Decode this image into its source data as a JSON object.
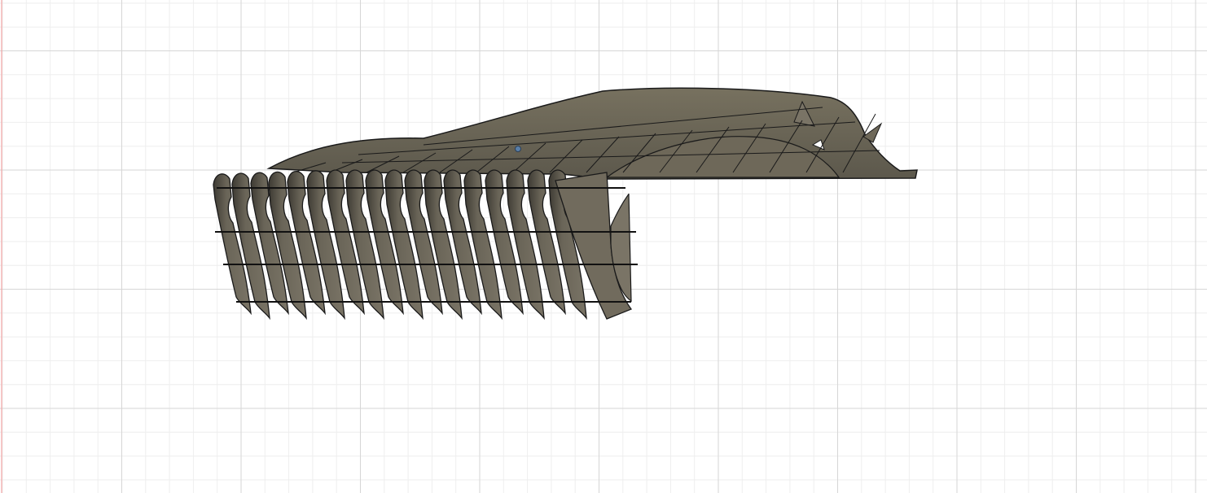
{
  "viewport": {
    "background": "#ffffff",
    "grid_minor_color": "#eeeeee",
    "grid_major_color": "#d6d6d6",
    "axis_color": "#f2a5a5",
    "model_fill": "#6a6558",
    "model_fill_dark": "#3d3a33",
    "model_stroke": "#1a1a1a",
    "origin_marker_color": "#5a7fa8"
  },
  "model": {
    "icon": "sliced-hull-model"
  }
}
